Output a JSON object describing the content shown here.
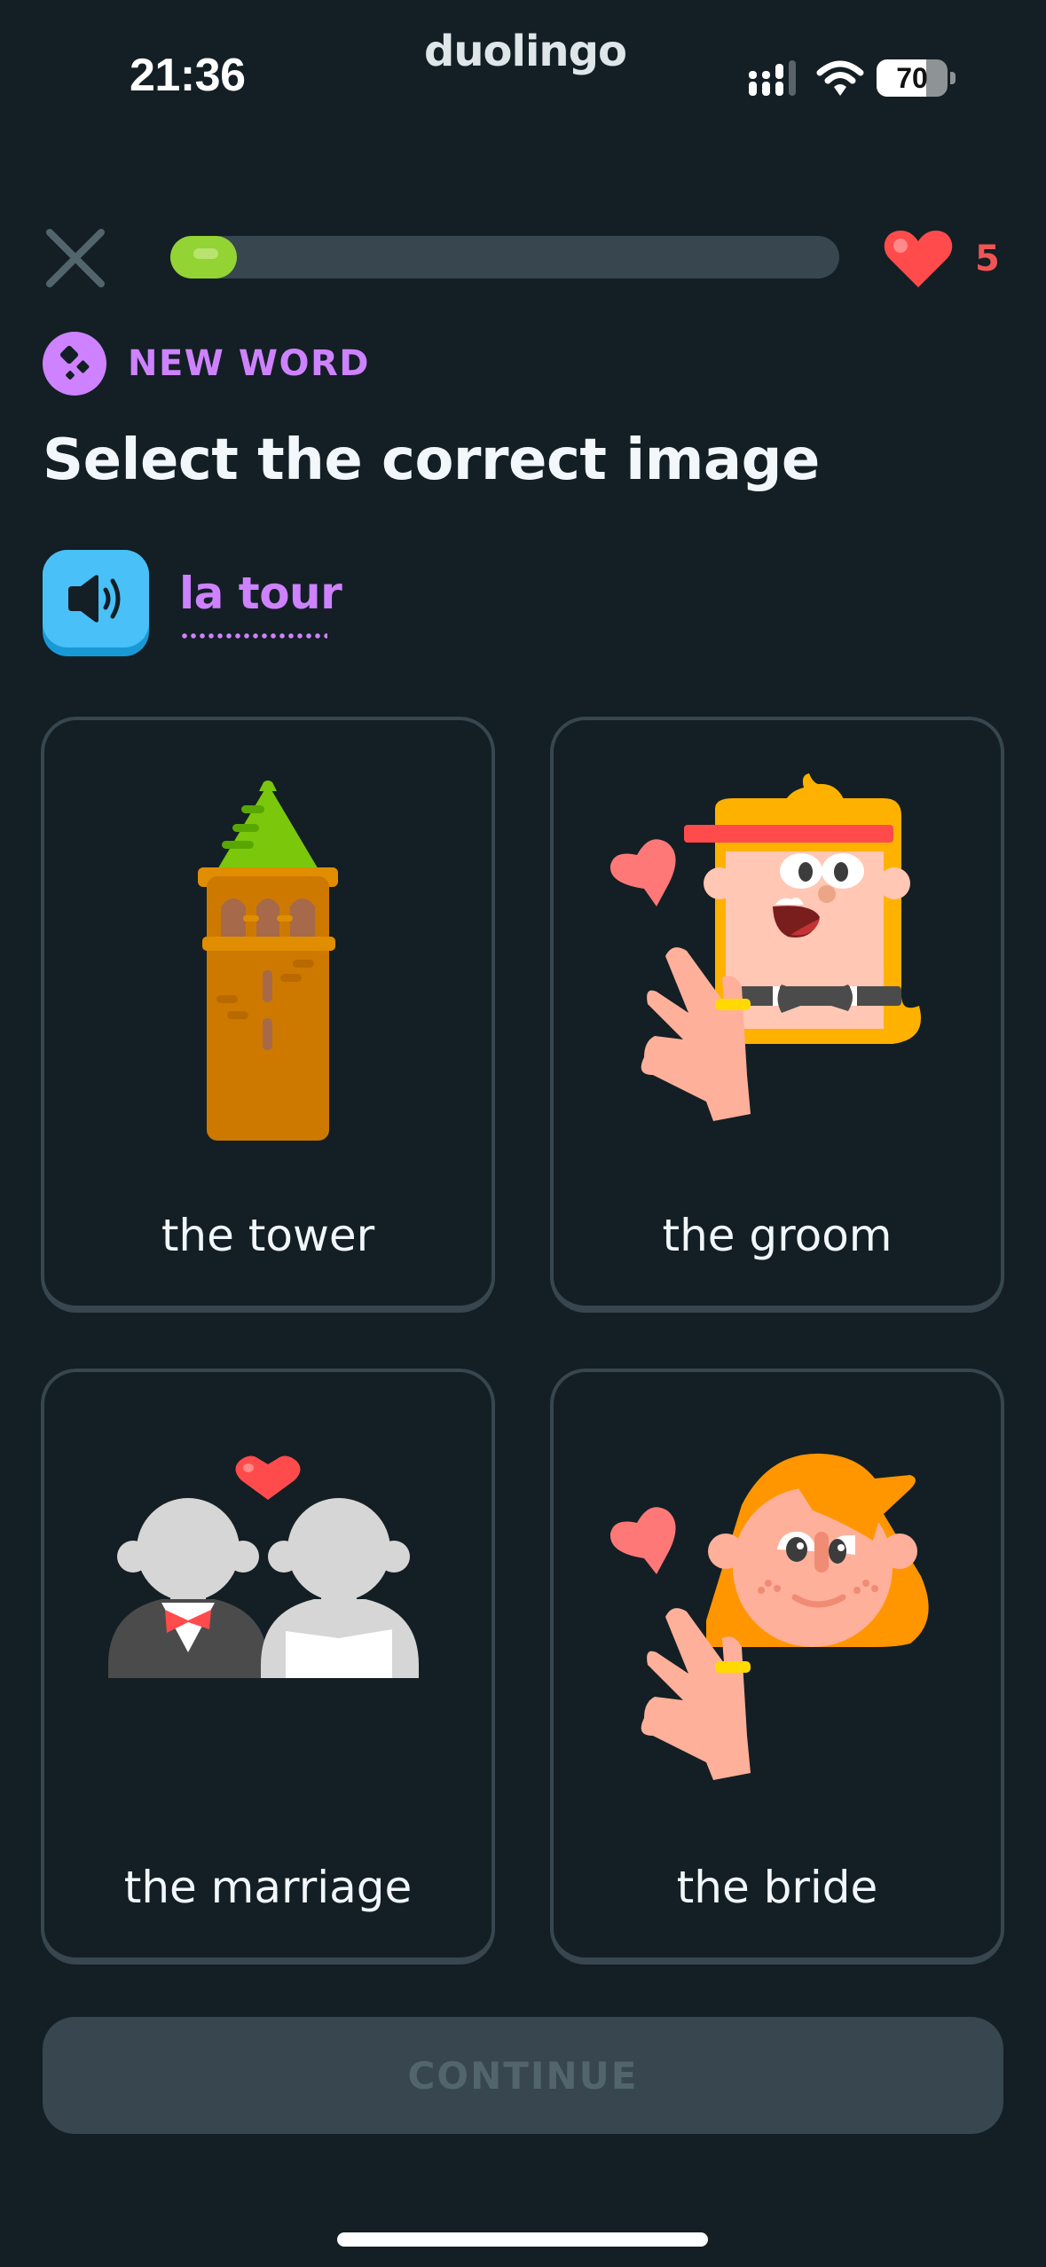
{
  "status_bar": {
    "time": "21:36",
    "app_label": "duolingo",
    "battery_level": 70,
    "battery_text": "70",
    "icons": [
      "cellular-signal-icon",
      "wifi-icon",
      "battery-icon"
    ]
  },
  "lesson": {
    "close_icon": "close-icon",
    "progress_fraction": 0.1,
    "hearts": "5",
    "heart_icon": "heart-icon"
  },
  "badge": {
    "icon": "new-word-icon",
    "label": "NEW WORD"
  },
  "prompt": {
    "title": "Select the correct image",
    "speaker_icon": "speaker-icon",
    "word": "la tour"
  },
  "choices": [
    {
      "label": "the tower",
      "image": "tower-illustration"
    },
    {
      "label": "the groom",
      "image": "groom-illustration"
    },
    {
      "label": "the marriage",
      "image": "marriage-illustration"
    },
    {
      "label": "the bride",
      "image": "bride-illustration"
    }
  ],
  "footer": {
    "continue_label": "CONTINUE",
    "continue_enabled": false
  },
  "colors": {
    "background": "#131f24",
    "accent_purple": "#ce82ff",
    "progress_green": "#93d333",
    "heart_red": "#ff4b4b",
    "speaker_blue": "#49c0f8",
    "card_border": "#37464f"
  }
}
